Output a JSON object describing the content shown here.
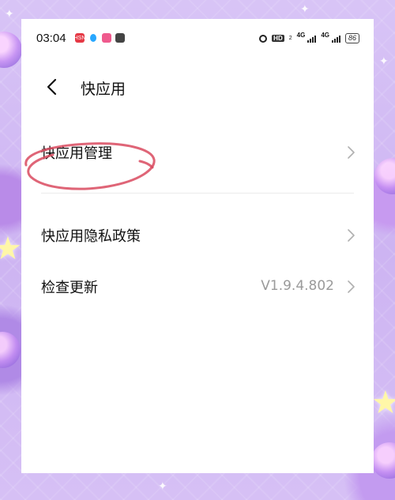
{
  "status_bar": {
    "time": "03:04",
    "apps": [
      {
        "icon": "app-red-icon",
        "text": "HSN",
        "color": "#e53945"
      },
      {
        "icon": "qq-icon",
        "text": "",
        "color": "#27a7ff"
      },
      {
        "icon": "app-pink-icon",
        "text": "",
        "color": "#ef5a8d"
      },
      {
        "icon": "app-gray-icon",
        "text": "",
        "color": "#444444"
      }
    ],
    "hd_label": "HD",
    "sim_number": "2",
    "network_1": "4G",
    "network_2": "4G",
    "battery": "86"
  },
  "header": {
    "back_icon": "chevron-left-icon",
    "title": "快应用"
  },
  "menu": {
    "items": [
      {
        "label": "快应用管理",
        "value": ""
      },
      {
        "label": "快应用隐私政策",
        "value": ""
      },
      {
        "label": "检查更新",
        "value": "V1.9.4.802"
      }
    ]
  },
  "colors": {
    "annotation_stroke": "#d94a5f",
    "value_text": "#9a9a9a",
    "chevron": "#b0b0b0"
  }
}
